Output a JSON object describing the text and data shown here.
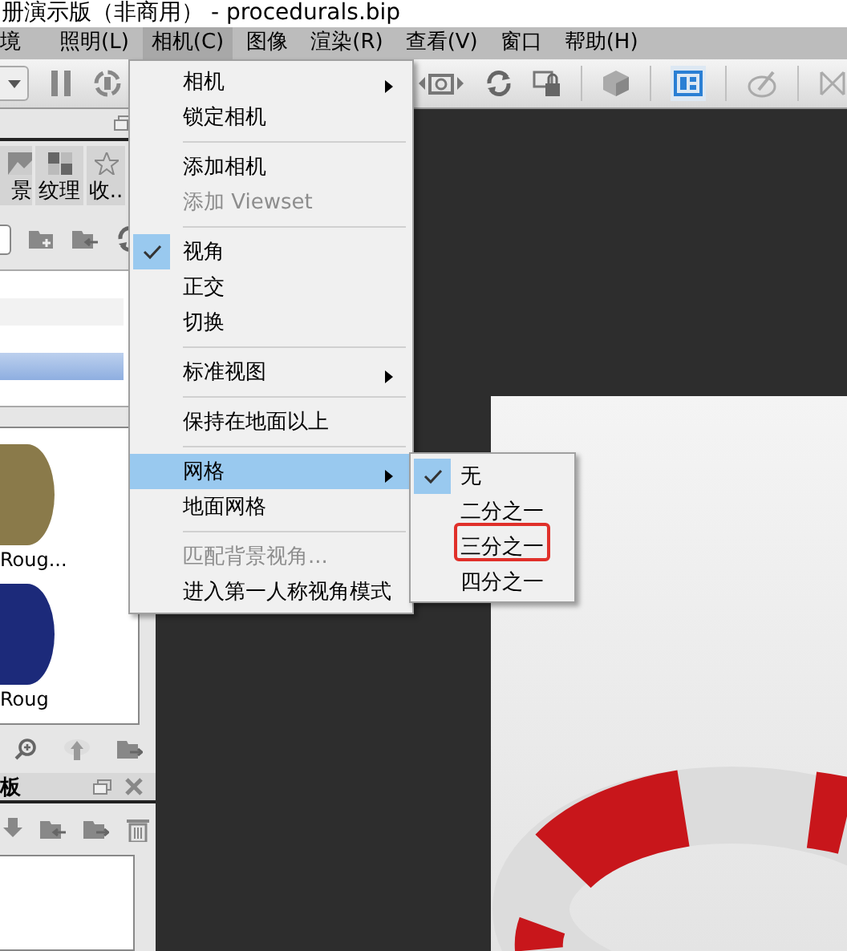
{
  "window": {
    "title": "册演示版（非商用）  - procedurals.bip"
  },
  "menubar": [
    {
      "label": "境",
      "selected": false
    },
    {
      "label": "照明(L)",
      "selected": false
    },
    {
      "label": "相机(C)",
      "selected": true
    },
    {
      "label": "图像",
      "selected": false
    },
    {
      "label": "渲染(R)",
      "selected": false
    },
    {
      "label": "查看(V)",
      "selected": false
    },
    {
      "label": "窗口",
      "selected": false
    },
    {
      "label": "帮助(H)",
      "selected": false
    }
  ],
  "toolbar": {
    "layout_toggle": {
      "on": true
    }
  },
  "library_panel": {
    "tabs": [
      {
        "label": "景",
        "selected": false
      },
      {
        "label": "纹理",
        "selected": false
      },
      {
        "label": "收..",
        "selected": false
      }
    ],
    "folder_rows": [
      {
        "selected": false
      },
      {
        "selected": true
      }
    ],
    "thumbnails": [
      {
        "label": "Roug...",
        "color": "#8a7a4a"
      },
      {
        "label": "Roug",
        "color": "#1c2a7a"
      }
    ]
  },
  "second_panel": {
    "title": "板"
  },
  "camera_menu": {
    "items": [
      {
        "kind": "item",
        "label": "相机",
        "submenu": true,
        "disabled": false,
        "checked": false,
        "selected": false
      },
      {
        "kind": "item",
        "label": "锁定相机",
        "submenu": false,
        "disabled": false,
        "checked": false,
        "selected": false
      },
      {
        "kind": "separator"
      },
      {
        "kind": "item",
        "label": "添加相机",
        "submenu": false,
        "disabled": false,
        "checked": false,
        "selected": false
      },
      {
        "kind": "item",
        "label": "添加 Viewset",
        "submenu": false,
        "disabled": true,
        "checked": false,
        "selected": false
      },
      {
        "kind": "separator"
      },
      {
        "kind": "item",
        "label": "视角",
        "submenu": false,
        "disabled": false,
        "checked": true,
        "selected": false
      },
      {
        "kind": "item",
        "label": "正交",
        "submenu": false,
        "disabled": false,
        "checked": false,
        "selected": false
      },
      {
        "kind": "item",
        "label": "切换",
        "submenu": false,
        "disabled": false,
        "checked": false,
        "selected": false
      },
      {
        "kind": "separator"
      },
      {
        "kind": "item",
        "label": "标准视图",
        "submenu": true,
        "disabled": false,
        "checked": false,
        "selected": false
      },
      {
        "kind": "separator"
      },
      {
        "kind": "item",
        "label": "保持在地面以上",
        "submenu": false,
        "disabled": false,
        "checked": false,
        "selected": false
      },
      {
        "kind": "separator"
      },
      {
        "kind": "item",
        "label": "网格",
        "submenu": true,
        "disabled": false,
        "checked": false,
        "selected": true
      },
      {
        "kind": "item",
        "label": "地面网格",
        "submenu": false,
        "disabled": false,
        "checked": false,
        "selected": false
      },
      {
        "kind": "separator"
      },
      {
        "kind": "item",
        "label": "匹配背景视角...",
        "submenu": false,
        "disabled": true,
        "checked": false,
        "selected": false
      },
      {
        "kind": "item",
        "label": "进入第一人称视角模式",
        "submenu": false,
        "disabled": false,
        "checked": false,
        "selected": false
      }
    ]
  },
  "grid_submenu": {
    "items": [
      {
        "label": "无",
        "checked": true,
        "annotated": false
      },
      {
        "label": "二分之一",
        "checked": false,
        "annotated": false
      },
      {
        "label": "三分之一",
        "checked": false,
        "annotated": true
      },
      {
        "label": "四分之一",
        "checked": false,
        "annotated": false
      }
    ]
  }
}
